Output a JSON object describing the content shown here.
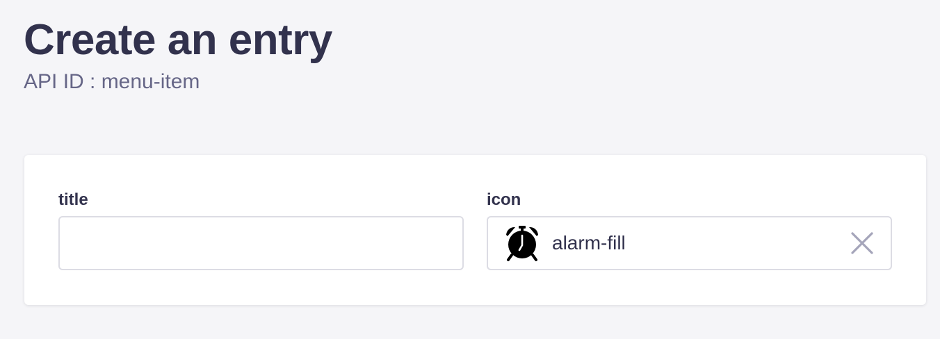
{
  "header": {
    "title": "Create an entry",
    "api_id": "API ID : menu-item"
  },
  "form": {
    "title_field": {
      "label": "title",
      "value": "",
      "placeholder": ""
    },
    "icon_field": {
      "label": "icon",
      "value": "alarm-fill",
      "icon": "alarm-fill-icon"
    }
  },
  "colors": {
    "background": "#f5f5f8",
    "text_primary": "#32324d",
    "text_secondary": "#666687",
    "border": "#dcdce4",
    "clear_icon": "#a5a5ba"
  }
}
